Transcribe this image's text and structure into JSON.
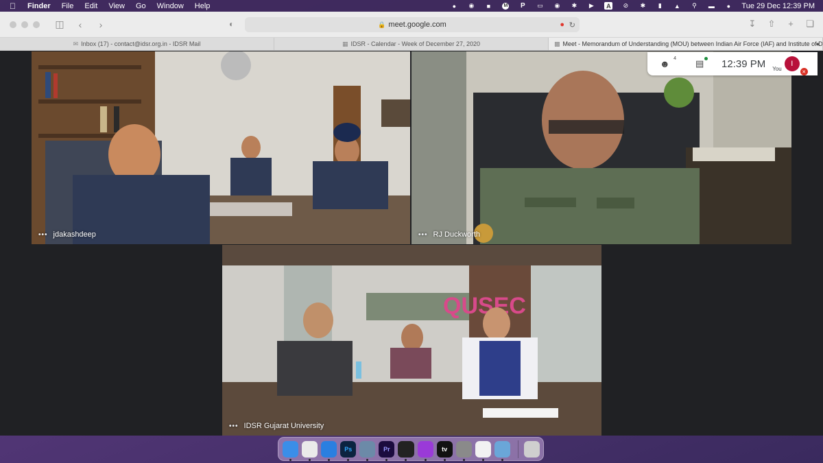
{
  "menubar": {
    "app_name": "Finder",
    "items": [
      "File",
      "Edit",
      "View",
      "Go",
      "Window",
      "Help"
    ],
    "status_icons": [
      "mic-icon",
      "paint-icon",
      "stop-icon",
      "m-icon",
      "p-icon",
      "display-icon",
      "eye-icon",
      "bluetooth-icon",
      "play-icon",
      "a-input-icon",
      "wifi-off-icon",
      "bluetooth-icon-2",
      "battery-icon",
      "wifi-icon",
      "search-icon",
      "control-center-icon",
      "siri-icon"
    ],
    "input_label": "A",
    "m_label": "M",
    "p_label": "P",
    "clock": "Tue 29 Dec  12:39 PM"
  },
  "browser": {
    "url": "meet.google.com",
    "tabs": [
      {
        "title": "Inbox (17) - contact@idsr.org.in - IDSR Mail",
        "icon": "mail-icon"
      },
      {
        "title": "IDSR - Calendar - Week of December 27, 2020",
        "icon": "calendar-icon"
      },
      {
        "title": "Meet - Memorandum of Understanding (MOU) between Indian Air Force (IAF) and Institute of D...",
        "icon": "camera-icon"
      }
    ]
  },
  "meet": {
    "participants_count": "4",
    "time": "12:39  PM",
    "you_label": "You",
    "avatar_initial": "I",
    "tiles": [
      {
        "name": "jdakashdeep"
      },
      {
        "name": "RJ Duckworth"
      },
      {
        "name": "IDSR Gujarat University"
      }
    ],
    "dots": "•••"
  },
  "dock": {
    "apps": [
      {
        "name": "finder",
        "color": "#3b8ee8",
        "label": ""
      },
      {
        "name": "chrome",
        "color": "#eaeaea",
        "label": ""
      },
      {
        "name": "safari",
        "color": "#2a7fe0",
        "label": ""
      },
      {
        "name": "photoshop",
        "color": "#0b2340",
        "label": "Ps"
      },
      {
        "name": "preview",
        "color": "#6c8aa8",
        "label": ""
      },
      {
        "name": "premiere",
        "color": "#1b0b3e",
        "label": "Pr"
      },
      {
        "name": "final-cut",
        "color": "#222",
        "label": ""
      },
      {
        "name": "podcasts",
        "color": "#9a3ad8",
        "label": ""
      },
      {
        "name": "apple-tv",
        "color": "#111",
        "label": "tv"
      },
      {
        "name": "system-preferences",
        "color": "#8a8a8a",
        "label": ""
      },
      {
        "name": "app-store-utility",
        "color": "#f2f2f2",
        "label": ""
      },
      {
        "name": "screen-sharing",
        "color": "#6aa6d8",
        "label": ""
      },
      {
        "name": "trash",
        "color": "#cfcfcf",
        "label": ""
      }
    ]
  }
}
